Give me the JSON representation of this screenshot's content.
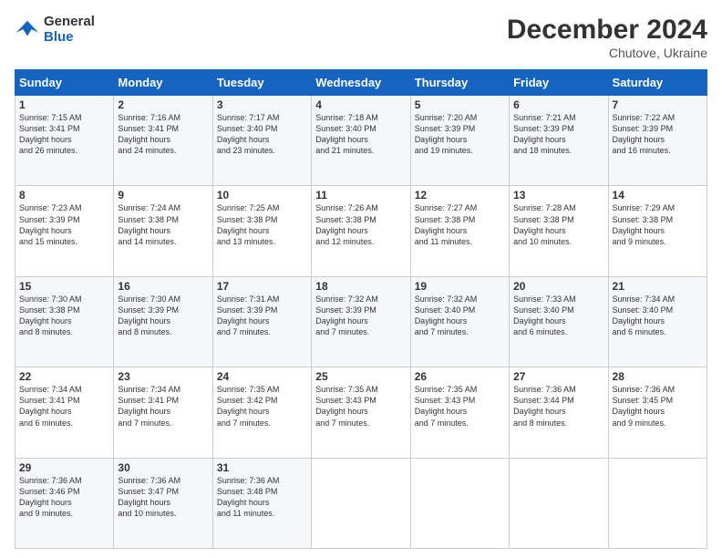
{
  "logo": {
    "line1": "General",
    "line2": "Blue"
  },
  "title": "December 2024",
  "subtitle": "Chutove, Ukraine",
  "days_of_week": [
    "Sunday",
    "Monday",
    "Tuesday",
    "Wednesday",
    "Thursday",
    "Friday",
    "Saturday"
  ],
  "weeks": [
    [
      {
        "day": "1",
        "sunrise": "7:15 AM",
        "sunset": "3:41 PM",
        "daylight": "8 hours and 26 minutes."
      },
      {
        "day": "2",
        "sunrise": "7:16 AM",
        "sunset": "3:41 PM",
        "daylight": "8 hours and 24 minutes."
      },
      {
        "day": "3",
        "sunrise": "7:17 AM",
        "sunset": "3:40 PM",
        "daylight": "8 hours and 23 minutes."
      },
      {
        "day": "4",
        "sunrise": "7:18 AM",
        "sunset": "3:40 PM",
        "daylight": "8 hours and 21 minutes."
      },
      {
        "day": "5",
        "sunrise": "7:20 AM",
        "sunset": "3:39 PM",
        "daylight": "8 hours and 19 minutes."
      },
      {
        "day": "6",
        "sunrise": "7:21 AM",
        "sunset": "3:39 PM",
        "daylight": "8 hours and 18 minutes."
      },
      {
        "day": "7",
        "sunrise": "7:22 AM",
        "sunset": "3:39 PM",
        "daylight": "8 hours and 16 minutes."
      }
    ],
    [
      {
        "day": "8",
        "sunrise": "7:23 AM",
        "sunset": "3:39 PM",
        "daylight": "8 hours and 15 minutes."
      },
      {
        "day": "9",
        "sunrise": "7:24 AM",
        "sunset": "3:38 PM",
        "daylight": "8 hours and 14 minutes."
      },
      {
        "day": "10",
        "sunrise": "7:25 AM",
        "sunset": "3:38 PM",
        "daylight": "8 hours and 13 minutes."
      },
      {
        "day": "11",
        "sunrise": "7:26 AM",
        "sunset": "3:38 PM",
        "daylight": "8 hours and 12 minutes."
      },
      {
        "day": "12",
        "sunrise": "7:27 AM",
        "sunset": "3:38 PM",
        "daylight": "8 hours and 11 minutes."
      },
      {
        "day": "13",
        "sunrise": "7:28 AM",
        "sunset": "3:38 PM",
        "daylight": "8 hours and 10 minutes."
      },
      {
        "day": "14",
        "sunrise": "7:29 AM",
        "sunset": "3:38 PM",
        "daylight": "8 hours and 9 minutes."
      }
    ],
    [
      {
        "day": "15",
        "sunrise": "7:30 AM",
        "sunset": "3:38 PM",
        "daylight": "8 hours and 8 minutes."
      },
      {
        "day": "16",
        "sunrise": "7:30 AM",
        "sunset": "3:39 PM",
        "daylight": "8 hours and 8 minutes."
      },
      {
        "day": "17",
        "sunrise": "7:31 AM",
        "sunset": "3:39 PM",
        "daylight": "8 hours and 7 minutes."
      },
      {
        "day": "18",
        "sunrise": "7:32 AM",
        "sunset": "3:39 PM",
        "daylight": "8 hours and 7 minutes."
      },
      {
        "day": "19",
        "sunrise": "7:32 AM",
        "sunset": "3:40 PM",
        "daylight": "8 hours and 7 minutes."
      },
      {
        "day": "20",
        "sunrise": "7:33 AM",
        "sunset": "3:40 PM",
        "daylight": "8 hours and 6 minutes."
      },
      {
        "day": "21",
        "sunrise": "7:34 AM",
        "sunset": "3:40 PM",
        "daylight": "8 hours and 6 minutes."
      }
    ],
    [
      {
        "day": "22",
        "sunrise": "7:34 AM",
        "sunset": "3:41 PM",
        "daylight": "8 hours and 6 minutes."
      },
      {
        "day": "23",
        "sunrise": "7:34 AM",
        "sunset": "3:41 PM",
        "daylight": "8 hours and 7 minutes."
      },
      {
        "day": "24",
        "sunrise": "7:35 AM",
        "sunset": "3:42 PM",
        "daylight": "8 hours and 7 minutes."
      },
      {
        "day": "25",
        "sunrise": "7:35 AM",
        "sunset": "3:43 PM",
        "daylight": "8 hours and 7 minutes."
      },
      {
        "day": "26",
        "sunrise": "7:35 AM",
        "sunset": "3:43 PM",
        "daylight": "8 hours and 7 minutes."
      },
      {
        "day": "27",
        "sunrise": "7:36 AM",
        "sunset": "3:44 PM",
        "daylight": "8 hours and 8 minutes."
      },
      {
        "day": "28",
        "sunrise": "7:36 AM",
        "sunset": "3:45 PM",
        "daylight": "8 hours and 9 minutes."
      }
    ],
    [
      {
        "day": "29",
        "sunrise": "7:36 AM",
        "sunset": "3:46 PM",
        "daylight": "8 hours and 9 minutes."
      },
      {
        "day": "30",
        "sunrise": "7:36 AM",
        "sunset": "3:47 PM",
        "daylight": "8 hours and 10 minutes."
      },
      {
        "day": "31",
        "sunrise": "7:36 AM",
        "sunset": "3:48 PM",
        "daylight": "8 hours and 11 minutes."
      },
      null,
      null,
      null,
      null
    ]
  ]
}
